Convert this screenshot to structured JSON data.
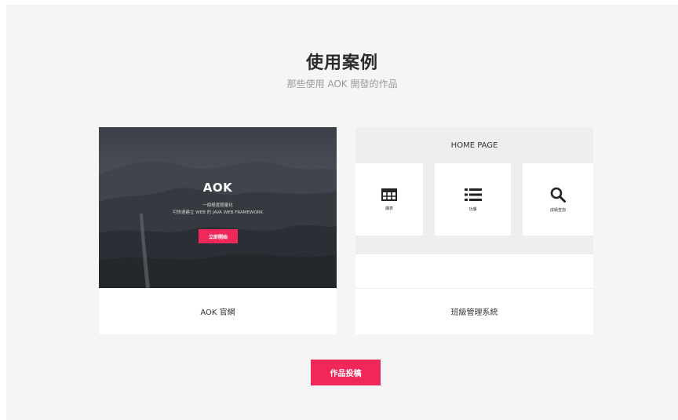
{
  "section": {
    "title": "使用案例",
    "subtitle": "那些使用 AOK 開發的作品"
  },
  "cards": [
    {
      "hero": {
        "title": "AOK",
        "line1": "一個極度輕量化",
        "line2": "可快速建立 WEB 的 JAVA WEB FRAMEWORK",
        "button": "立即開始"
      },
      "label": "AOK 官網"
    },
    {
      "preview": {
        "header": "HOME PAGE",
        "tiles": [
          {
            "icon": "table-icon",
            "label": "課表"
          },
          {
            "icon": "list-icon",
            "label": "功課"
          },
          {
            "icon": "search-icon",
            "label": "成績查詢"
          }
        ]
      },
      "label": "班級管理系統"
    }
  ],
  "submit_button": "作品投稿",
  "colors": {
    "accent": "#f0285a",
    "background": "#f5f5f5",
    "card": "#ffffff",
    "preview_gray": "#eeeeee"
  }
}
